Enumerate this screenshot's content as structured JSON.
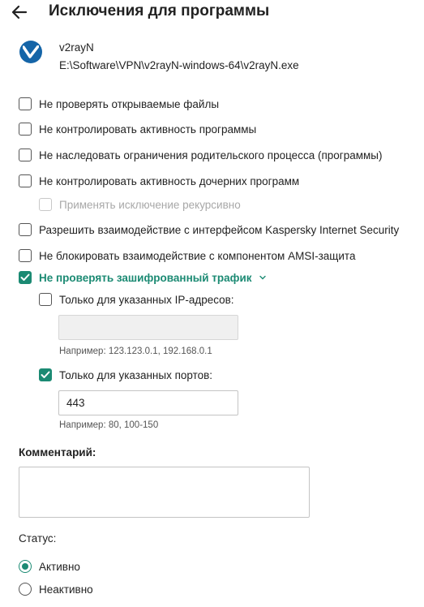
{
  "header": {
    "title": "Исключения для программы",
    "back_icon": "arrow-left-icon"
  },
  "app": {
    "name": "v2rayN",
    "path": "E:\\Software\\VPN\\v2rayN-windows-64\\v2rayN.exe",
    "icon": "v2rayn-logo-icon"
  },
  "options": [
    {
      "label": "Не проверять открываемые файлы",
      "checked": false,
      "disabled": false
    },
    {
      "label": "Не контролировать активность программы",
      "checked": false,
      "disabled": false
    },
    {
      "label": "Не наследовать ограничения родительского процесса (программы)",
      "checked": false,
      "disabled": false
    },
    {
      "label": "Не контролировать активность дочерних программ",
      "checked": false,
      "disabled": false
    },
    {
      "label": "Применять исключение рекурсивно",
      "checked": false,
      "disabled": true
    },
    {
      "label": "Разрешить взаимодействие с интерфейсом Kaspersky Internet Security",
      "checked": false,
      "disabled": false
    },
    {
      "label": "Не блокировать взаимодействие с компонентом AMSI-защита",
      "checked": false,
      "disabled": false
    },
    {
      "label": "Не проверять зашифрованный трафик",
      "checked": true,
      "disabled": false
    }
  ],
  "encrypted_traffic": {
    "ip_only": {
      "label": "Только для указанных IP-адресов:",
      "checked": false,
      "value": "",
      "hint": "Например: 123.123.0.1, 192.168.0.1"
    },
    "ports_only": {
      "label": "Только для указанных портов:",
      "checked": true,
      "value": "443",
      "hint": "Например: 80, 100-150"
    }
  },
  "comment": {
    "label": "Комментарий:",
    "value": ""
  },
  "status": {
    "label": "Статус:",
    "options": [
      {
        "label": "Активно",
        "selected": true
      },
      {
        "label": "Неактивно",
        "selected": false
      }
    ]
  },
  "colors": {
    "accent": "#1b8a73",
    "disabled_text": "#a8a8a8"
  }
}
